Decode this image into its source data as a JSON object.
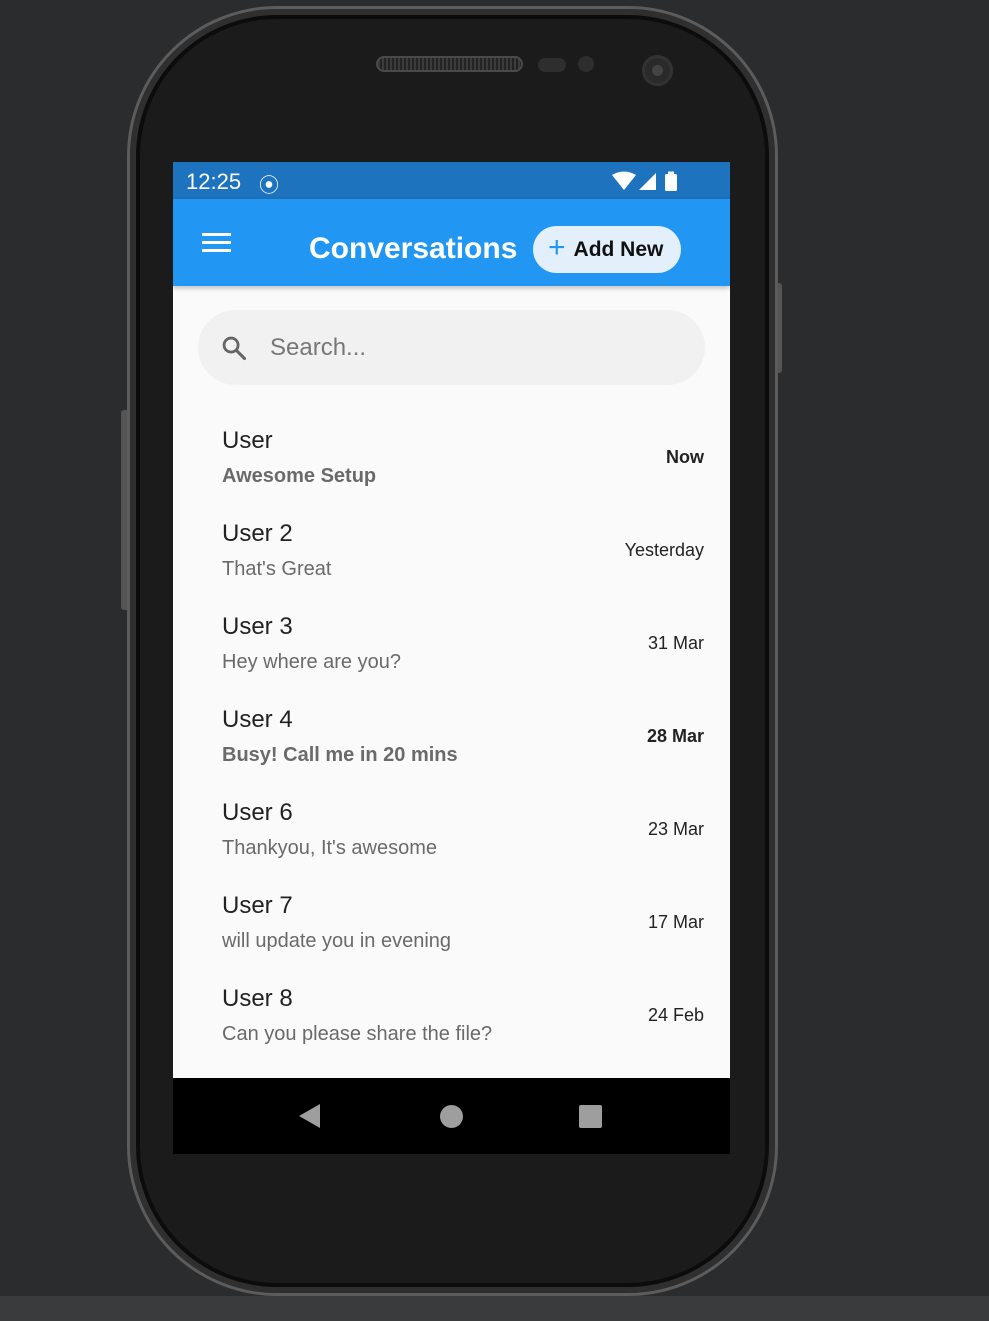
{
  "status_bar": {
    "time": "12:25",
    "sim_icon": "sim-settings-icon",
    "icons": [
      "wifi-icon",
      "signal-icon",
      "battery-icon"
    ]
  },
  "app_bar": {
    "menu_icon": "menu-icon",
    "title": "Conversations",
    "add_button": {
      "icon": "plus-icon",
      "label": "Add New"
    }
  },
  "search": {
    "icon": "search-icon",
    "placeholder": "Search...",
    "value": ""
  },
  "conversations": [
    {
      "name": "User",
      "message": "Awesome Setup",
      "date": "Now",
      "unread": true
    },
    {
      "name": "User 2",
      "message": "That's Great",
      "date": "Yesterday",
      "unread": false
    },
    {
      "name": "User 3",
      "message": "Hey where are you?",
      "date": "31 Mar",
      "unread": false
    },
    {
      "name": "User 4",
      "message": "Busy! Call me in 20 mins",
      "date": "28 Mar",
      "unread": true
    },
    {
      "name": "User 6",
      "message": "Thankyou, It's awesome",
      "date": "23 Mar",
      "unread": false
    },
    {
      "name": "User 7",
      "message": "will update you in evening",
      "date": "17 Mar",
      "unread": false
    },
    {
      "name": "User 8",
      "message": "Can you please share the file?",
      "date": "24 Feb",
      "unread": false
    }
  ],
  "nav_bar": [
    "back-icon",
    "home-icon",
    "recents-icon"
  ],
  "colors": {
    "status_bar": "#1e73be",
    "app_bar": "#2196f3",
    "accent": "#2196f3",
    "background": "#fafafa"
  }
}
